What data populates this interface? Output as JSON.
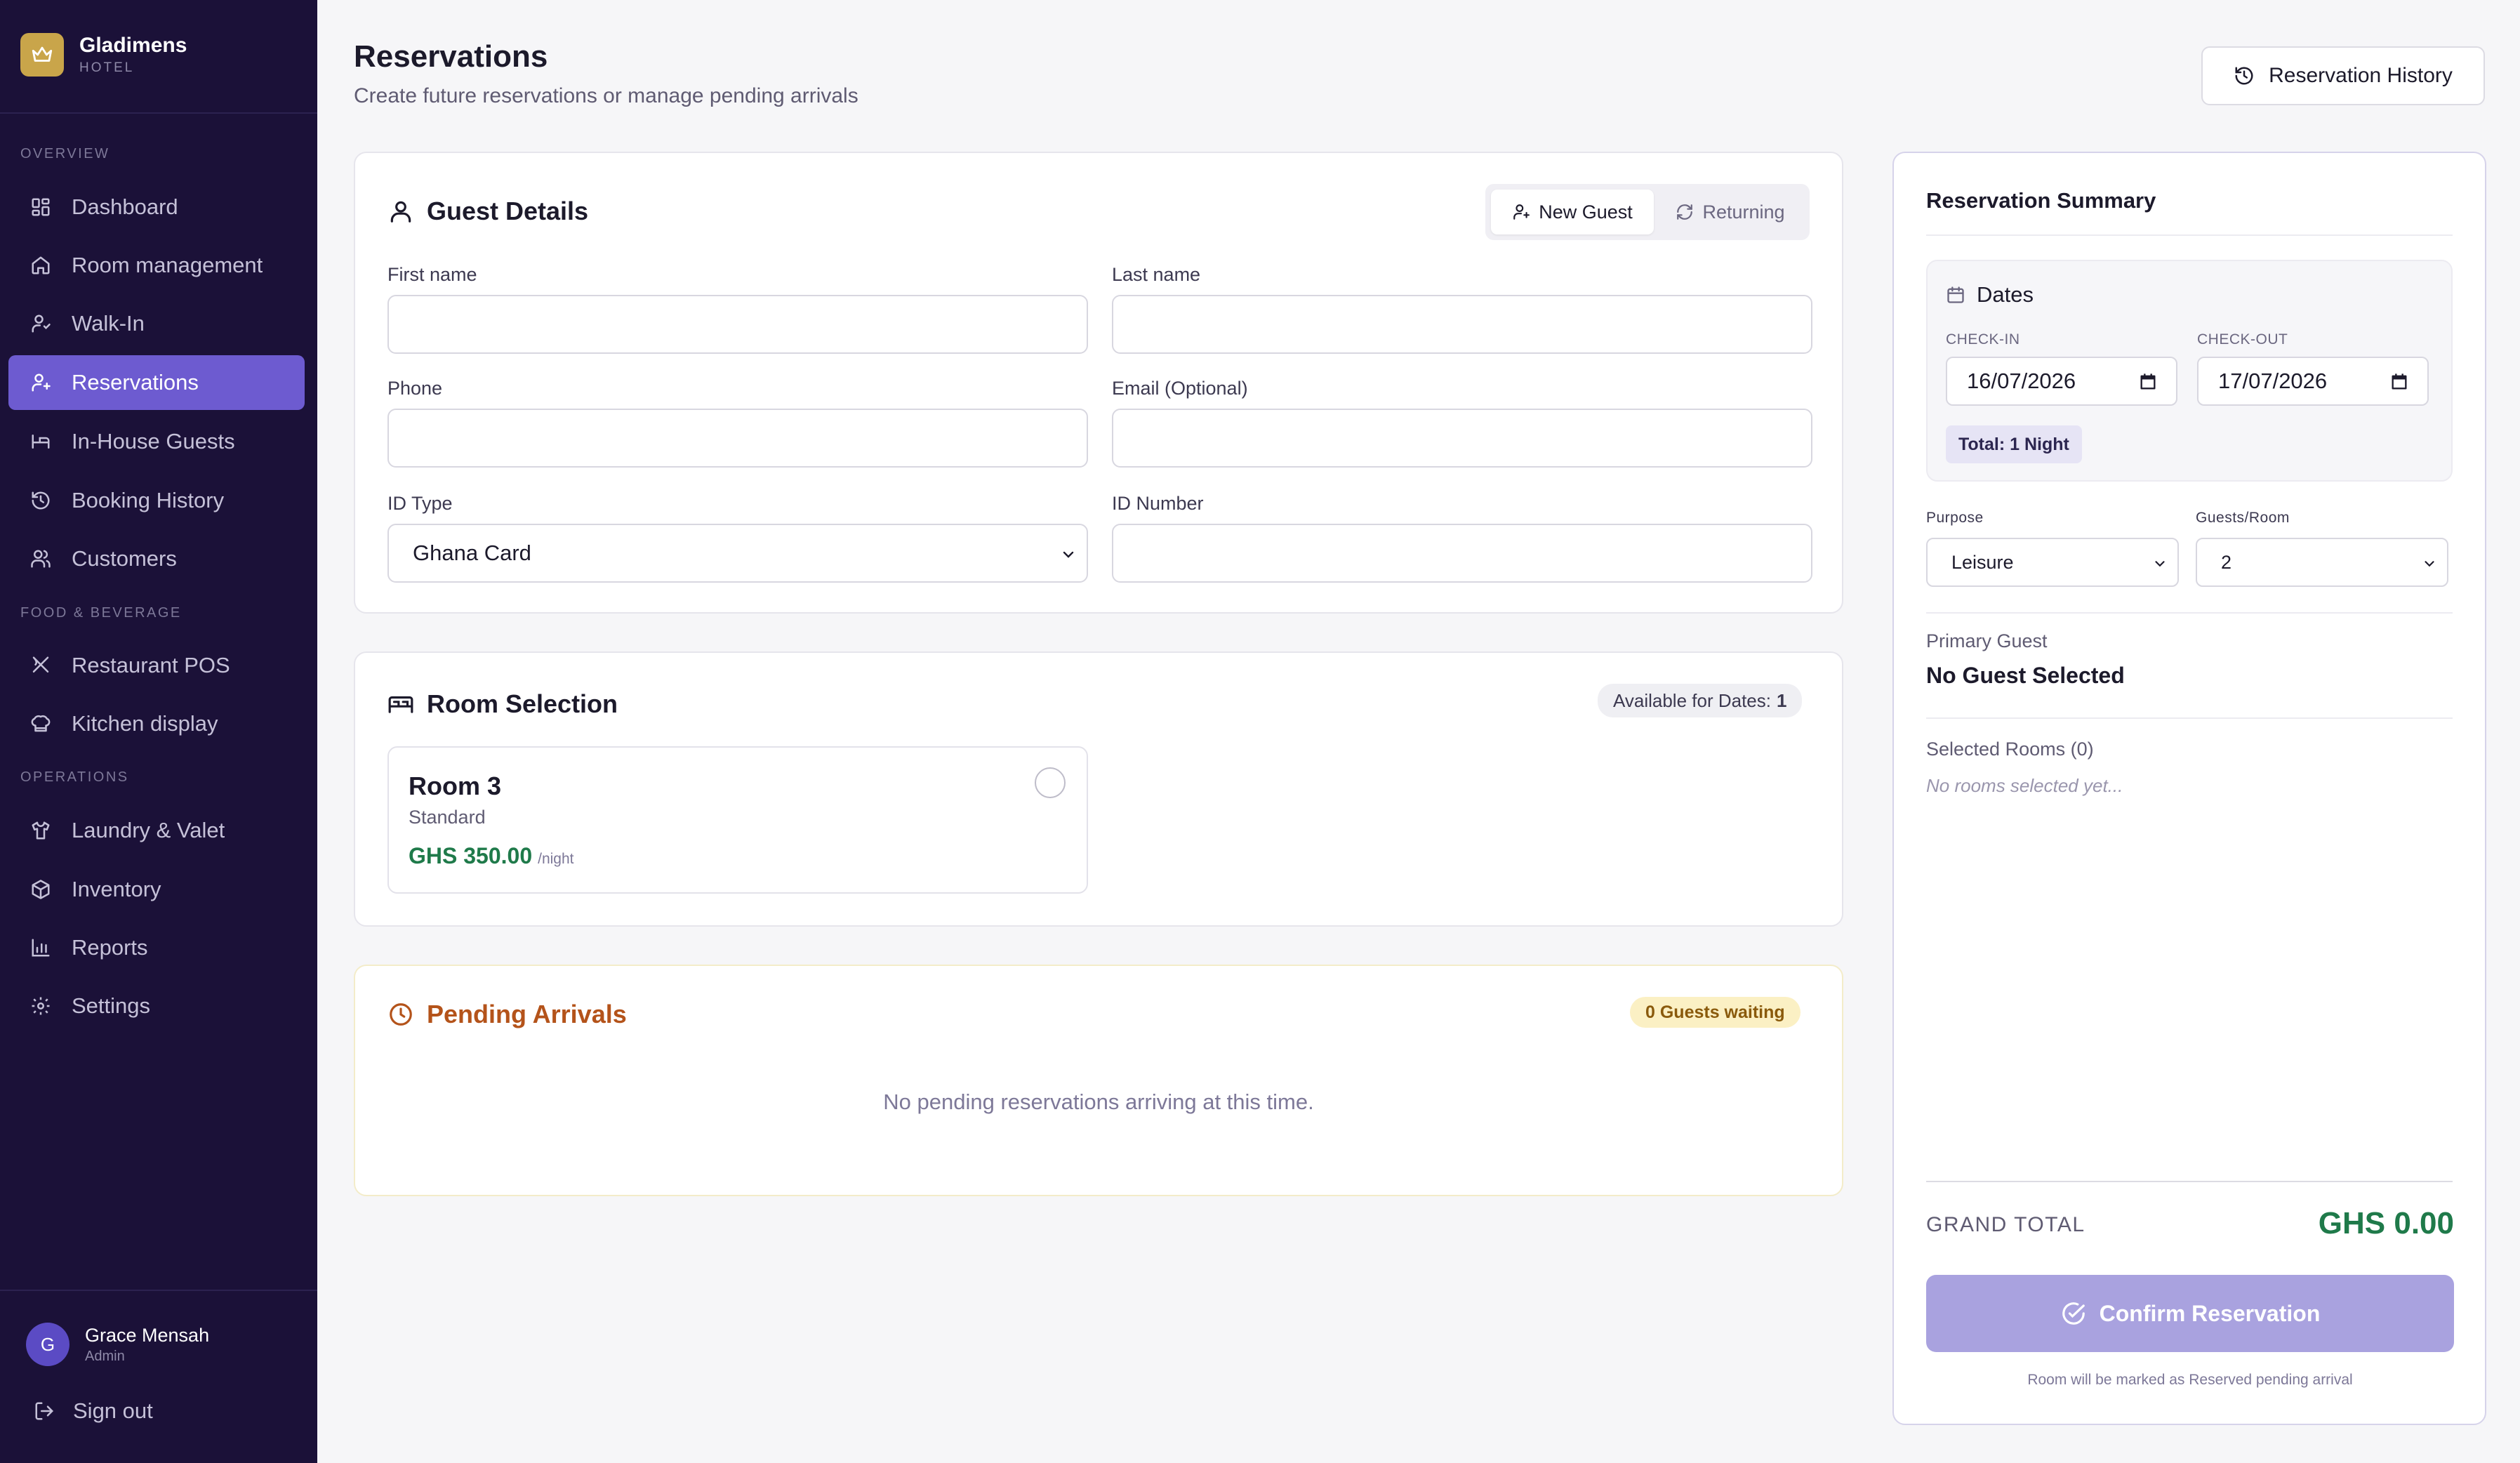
{
  "brand": {
    "name": "Gladimens",
    "subtitle": "HOTEL"
  },
  "nav": {
    "overview_label": "OVERVIEW",
    "food_label": "FOOD & BEVERAGE",
    "operations_label": "OPERATIONS",
    "items": [
      {
        "label": "Dashboard",
        "icon": "grid-icon"
      },
      {
        "label": "Room management",
        "icon": "home-icon"
      },
      {
        "label": "Walk-In",
        "icon": "user-walk-icon"
      },
      {
        "label": "Reservations",
        "icon": "user-plus-icon",
        "active": true
      },
      {
        "label": "In-House Guests",
        "icon": "bed-icon"
      },
      {
        "label": "Booking History",
        "icon": "history-icon"
      },
      {
        "label": "Customers",
        "icon": "users-icon"
      },
      {
        "label": "Restaurant POS",
        "icon": "utensils-icon"
      },
      {
        "label": "Kitchen display",
        "icon": "chef-hat-icon"
      },
      {
        "label": "Laundry & Valet",
        "icon": "shirt-icon"
      },
      {
        "label": "Inventory",
        "icon": "package-icon"
      },
      {
        "label": "Reports",
        "icon": "bar-chart-icon"
      },
      {
        "label": "Settings",
        "icon": "gear-icon"
      }
    ]
  },
  "user": {
    "initial": "G",
    "name": "Grace Mensah",
    "role": "Admin"
  },
  "signout_label": "Sign out",
  "header": {
    "title": "Reservations",
    "subtitle": "Create future reservations or manage pending arrivals",
    "history_button": "Reservation History"
  },
  "guest": {
    "title": "Guest Details",
    "toggle_new": "New Guest",
    "toggle_returning": "Returning",
    "first_name_label": "First name",
    "first_name_value": "",
    "last_name_label": "Last name",
    "last_name_value": "",
    "phone_label": "Phone",
    "phone_value": "",
    "email_label": "Email (Optional)",
    "email_value": "",
    "id_type_label": "ID Type",
    "id_type_value": "Ghana Card",
    "id_number_label": "ID Number",
    "id_number_value": ""
  },
  "rooms": {
    "title": "Room Selection",
    "available_label": "Available for Dates:",
    "available_count": "1",
    "list": [
      {
        "name": "Room 3",
        "type": "Standard",
        "price": "GHS 350.00",
        "unit": "/night"
      }
    ]
  },
  "pending": {
    "title": "Pending Arrivals",
    "badge": "0 Guests waiting",
    "empty": "No pending reservations arriving at this time."
  },
  "summary": {
    "title": "Reservation Summary",
    "dates_title": "Dates",
    "checkin_label": "CHECK-IN",
    "checkin_value": "16/07/2026",
    "checkout_label": "CHECK-OUT",
    "checkout_value": "17/07/2026",
    "total_nights": "Total: 1 Night",
    "purpose_label": "Purpose",
    "purpose_value": "Leisure",
    "guests_label": "Guests/Room",
    "guests_value": "2",
    "primary_label": "Primary Guest",
    "primary_value": "No Guest Selected",
    "selected_label": "Selected Rooms (0)",
    "selected_empty": "No rooms selected yet...",
    "grand_label": "GRAND TOTAL",
    "grand_value": "GHS 0.00",
    "confirm": "Confirm Reservation",
    "footnote": "Room will be marked as Reserved pending arrival"
  },
  "colors": {
    "sidebar_bg": "#1b1138",
    "accent": "#6d5bd0",
    "brand_gold": "#c9a54a",
    "money_green": "#1f7a4a",
    "pending_orange": "#b4531a"
  }
}
